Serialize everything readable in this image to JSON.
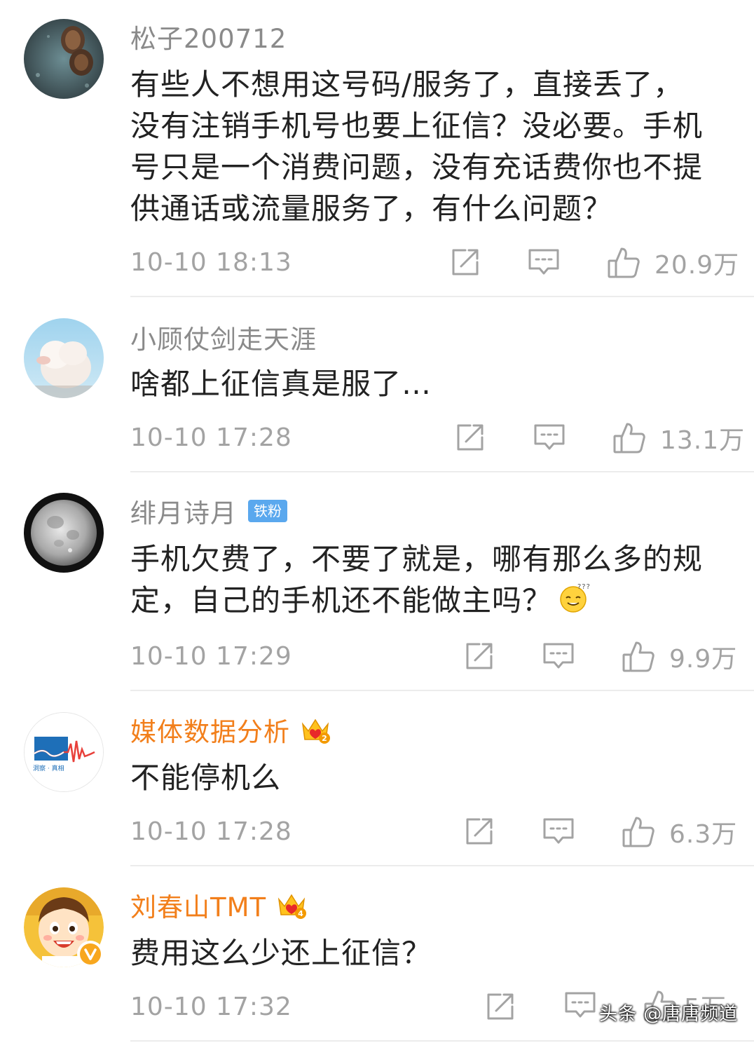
{
  "comments": [
    {
      "username": "松子200712",
      "lines": [
        "有些人不想用这号码/服务了，直接丢了，",
        "没有注销手机号也要上征信？没必要。手机",
        "号只是一个消费问题，没有充话费你也不提",
        "供通话或流量服务了，有什么问题？"
      ],
      "time": "10-10 18:13",
      "likes": "20.9万"
    },
    {
      "username": "小顾仗剑走天涯",
      "lines": [
        "啥都上征信真是服了…"
      ],
      "time": "10-10 17:28",
      "likes": "13.1万"
    },
    {
      "username": "绯月诗月",
      "badge": "铁粉",
      "lines": [
        "手机欠费了，不要了就是，哪有那么多的规",
        "定，自己的手机还不能做主吗？"
      ],
      "emoji": "confused-smile-emoji",
      "time": "10-10 17:29",
      "likes": "9.9万"
    },
    {
      "username": "媒体数据分析",
      "crown_level": "2",
      "avatar_text": "洞察 · 真相",
      "lines": [
        "不能停机么"
      ],
      "time": "10-10 17:28",
      "likes": "6.3万"
    },
    {
      "username": "刘春山TMT",
      "crown_level": "4",
      "lines": [
        "费用这么少还上征信？"
      ],
      "time": "10-10 17:32",
      "likes": "5万"
    }
  ],
  "watermark": "头条 @唐唐频道",
  "colors": {
    "vip_name": "#f27f1b",
    "normal_name": "#8a8a8a",
    "meta": "#a3a3a3",
    "text": "#222222",
    "fan_badge": "#5aa8ee"
  },
  "icons": {
    "share": "share-icon",
    "comment": "comment-icon",
    "like": "thumbs-up-icon",
    "crown": "crown-icon",
    "verified": "verified-v-icon"
  }
}
